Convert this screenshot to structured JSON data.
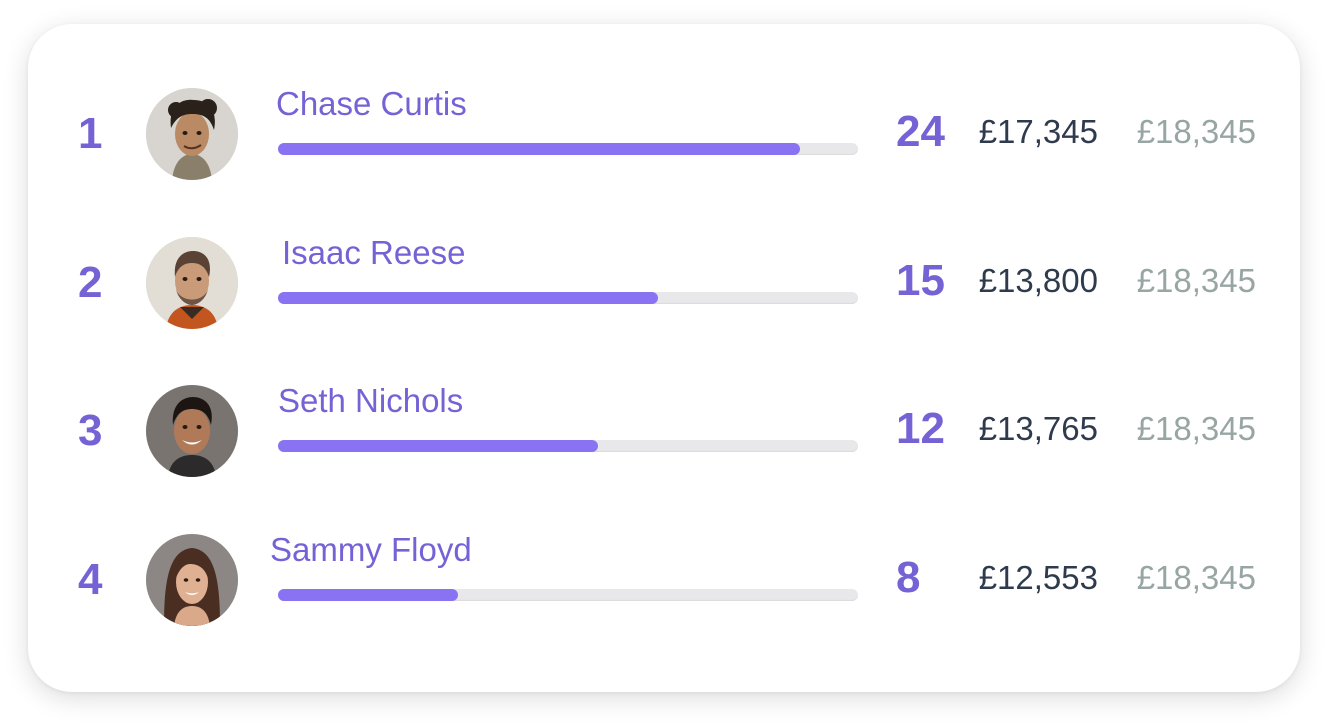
{
  "leaderboard": {
    "rows": [
      {
        "rank": "1",
        "name": "Chase Curtis",
        "progress": 0.9,
        "count": "24",
        "amount": "£17,345",
        "target": "£18,345"
      },
      {
        "rank": "2",
        "name": "Isaac Reese",
        "progress": 0.655,
        "count": "15",
        "amount": "£13,800",
        "target": "£18,345"
      },
      {
        "rank": "3",
        "name": "Seth Nichols",
        "progress": 0.552,
        "count": "12",
        "amount": "£13,765",
        "target": "£18,345"
      },
      {
        "rank": "4",
        "name": "Sammy Floyd",
        "progress": 0.31,
        "count": "8",
        "amount": "£12,553",
        "target": "£18,345"
      }
    ]
  },
  "colors": {
    "accent": "#7563d6",
    "bar_fill": "#8a73f3",
    "bar_track": "#e8e8ea",
    "amount_text": "#2f3a4d",
    "target_text": "#97a5a3"
  }
}
